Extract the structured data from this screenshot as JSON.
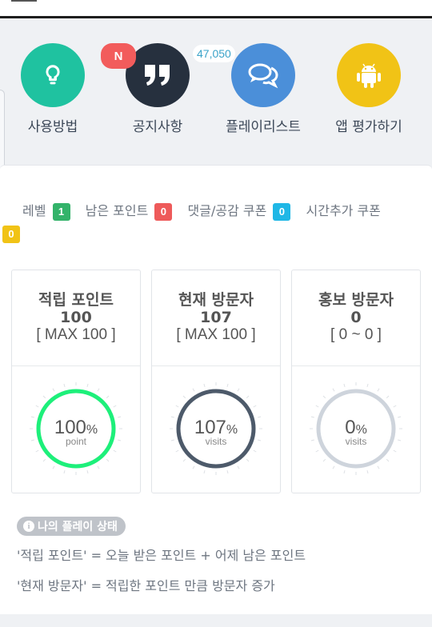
{
  "menu": {
    "items": [
      {
        "label": "사용방법",
        "icon": "lightbulb-icon",
        "color": "#1fc2a0"
      },
      {
        "label": "공지사항",
        "icon": "quote-icon",
        "color": "#26303e"
      },
      {
        "label": "플레이리스트",
        "icon": "chat-bubbles-icon",
        "color": "#4b8fd9"
      },
      {
        "label": "앱 평가하기",
        "icon": "android-icon",
        "color": "#f1c316"
      }
    ],
    "notice_badge": "N",
    "playlist_count": "47,050"
  },
  "stats": {
    "level_label": "레벨",
    "level_value": "1",
    "points_label": "남은 포인트",
    "points_value": "0",
    "comment_coupon_label": "댓글/공감 쿠폰",
    "comment_coupon_value": "0",
    "time_coupon_label": "시간추가 쿠폰",
    "time_coupon_value": "0"
  },
  "cards": [
    {
      "title": "적립 포인트",
      "value": "100",
      "range": "[ MAX 100 ]",
      "percent": 100,
      "percent_text": "100",
      "unit": "point",
      "ring_color": "#1df07a"
    },
    {
      "title": "현재 방문자",
      "value": "107",
      "range": "[ MAX 100 ]",
      "percent": 107,
      "percent_text": "107",
      "unit": "visits",
      "ring_color": "#4d5a6a"
    },
    {
      "title": "홍보 방문자",
      "value": "0",
      "range": "[ 0 ~ 0 ]",
      "percent": 0,
      "percent_text": "0",
      "unit": "visits",
      "ring_color": "#ced4dc"
    }
  ],
  "status": {
    "pill": "나의 플레이 상태",
    "note1": "'적립 포인트' = 오늘 받은 포인트 + 어제 남은 포인트",
    "note2": "'현재 방문자' = 적립한 포인트 만큼 방문자 증가"
  }
}
